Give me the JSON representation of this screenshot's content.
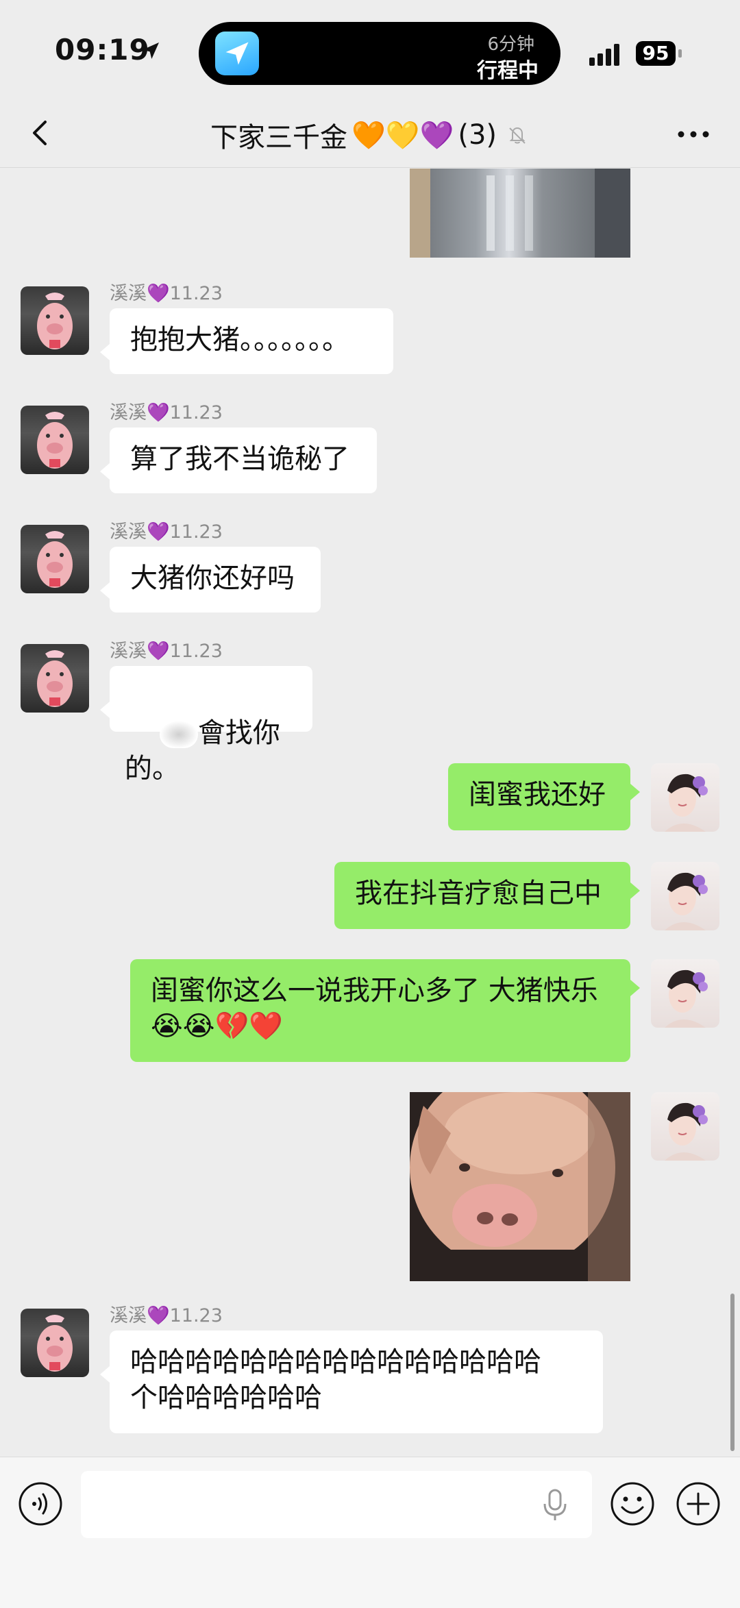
{
  "status_bar": {
    "time": "09:19",
    "island_sub": "6分钟",
    "island_main": "行程中",
    "battery": "95"
  },
  "nav": {
    "back_icon": "chevron-left-icon",
    "title_text": "下家三千金",
    "title_emojis": "🧡💛💜",
    "member_count": "(3)",
    "mute_icon": "bell-slash-icon",
    "more_icon": "more-dots-icon"
  },
  "messages": [
    {
      "type": "image",
      "direction": "out",
      "description": "cropped photo"
    },
    {
      "sender": "溪溪💜11.23",
      "text": "抱抱大猪。。。。。。。",
      "direction": "in"
    },
    {
      "sender": "溪溪💜11.23",
      "text": "算了我不当诡秘了",
      "direction": "in"
    },
    {
      "sender": "溪溪💜11.23",
      "text": "大猪你还好吗",
      "direction": "in"
    },
    {
      "sender": "溪溪💜11.23",
      "text": "會找你的。",
      "direction": "in"
    },
    {
      "text": "闺蜜我还好",
      "direction": "out"
    },
    {
      "text": "我在抖音疗愈自己中",
      "direction": "out"
    },
    {
      "text": "闺蜜你这么一说我开心多了 大猪快乐\n😭😭💔❤️",
      "direction": "out"
    },
    {
      "type": "image",
      "direction": "out"
    },
    {
      "sender": "溪溪💜11.23",
      "text": "哈哈哈哈哈哈哈哈哈哈哈哈哈哈哈\n个哈哈哈哈哈哈",
      "direction": "in"
    }
  ],
  "input_bar": {
    "voice_icon": "voice-wave-icon",
    "placeholder": "",
    "mic_icon": "microphone-icon",
    "emoji_icon": "smiley-icon",
    "plus_icon": "plus-icon"
  },
  "colors": {
    "background": "#ededed",
    "bubble_out": "#95ec69",
    "bubble_in": "#ffffff"
  }
}
